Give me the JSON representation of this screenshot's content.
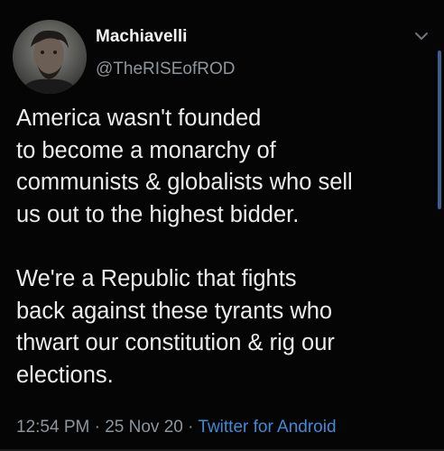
{
  "tweet": {
    "author": {
      "display_name": "Machiavelli",
      "handle": "@TheRISEofROD",
      "avatar_icon": "profile-photo"
    },
    "text": "America wasn't founded\nto become a monarchy of\ncommunists & globalists who sell\nus out to the highest bidder.\n\nWe're a Republic that fights\nback against these tyrants who\nthwart our constitution & rig our\nelections.",
    "time": "12:54 PM",
    "date": "25 Nov 20",
    "separator": " · ",
    "source": "Twitter for Android",
    "menu_icon": "chevron-down-icon"
  },
  "colors": {
    "background": "#050505",
    "text": "#ececec",
    "secondary_text": "#8d959c",
    "link": "#3e8bd6"
  }
}
